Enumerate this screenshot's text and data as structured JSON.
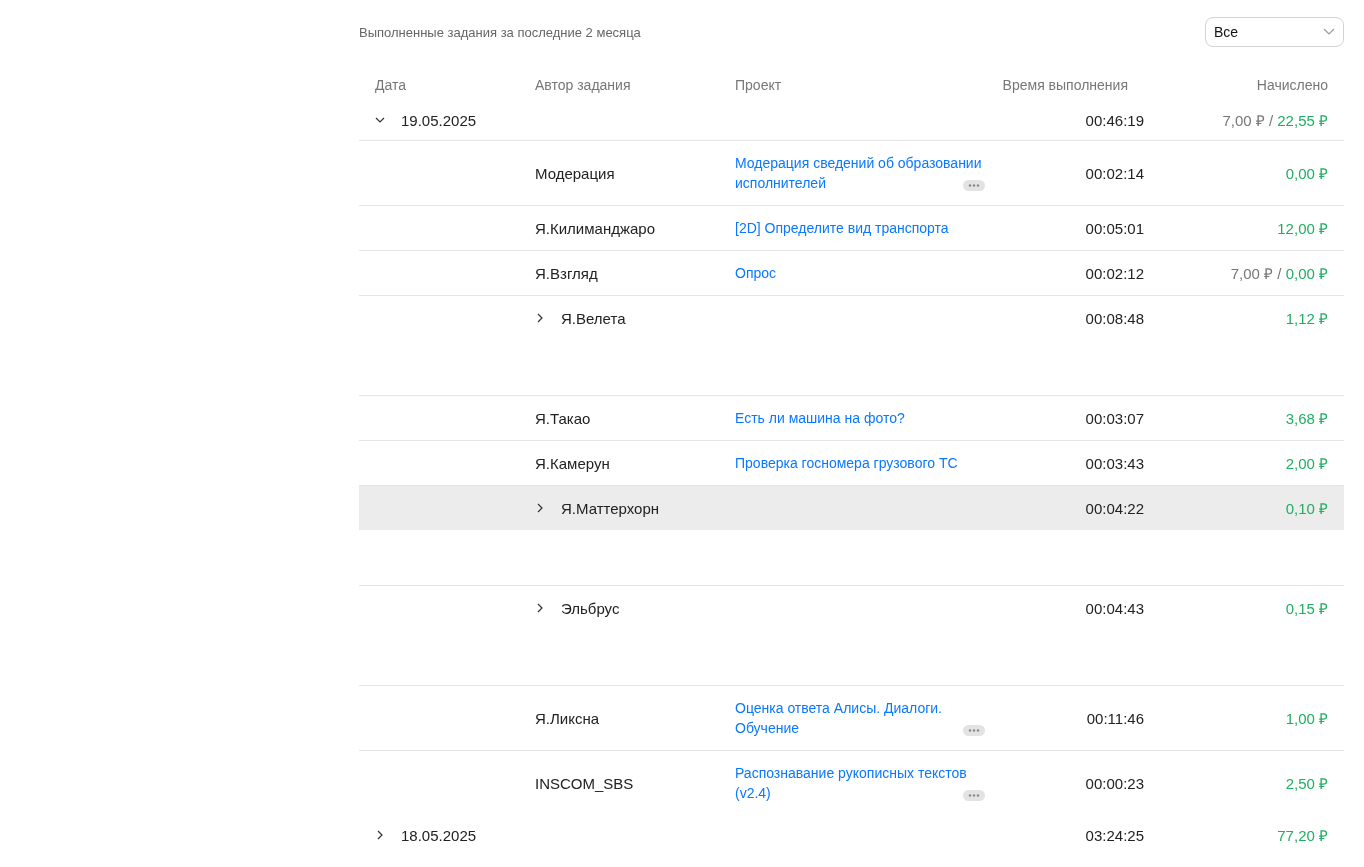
{
  "header": {
    "title": "Выполненные задания за последние 2 месяца",
    "filter": {
      "value": "Все"
    }
  },
  "columns": [
    "Дата",
    "Автор задания",
    "Проект",
    "Время выполнения",
    "Начислено"
  ],
  "groups": [
    {
      "date": "19.05.2025",
      "expanded": true,
      "time": "00:46:19",
      "pending": "7,00 ₽ /",
      "amount": "22,55 ₽",
      "rows": [
        {
          "kind": "task",
          "author": "Модерация",
          "project": "Модерация сведений об образовании исполнителей",
          "more": true,
          "time": "00:02:14",
          "amount": "0,00 ₽",
          "highlighted": false
        },
        {
          "kind": "task",
          "author": "Я.Килиманджаро",
          "project": "[2D] Определите вид транспорта",
          "more": false,
          "time": "00:05:01",
          "amount": "12,00 ₽",
          "highlighted": false
        },
        {
          "kind": "task",
          "author": "Я.Взгляд",
          "project": "Опрос",
          "more": false,
          "time": "00:02:12",
          "pending": "7,00 ₽ /",
          "amount": "0,00 ₽",
          "highlighted": false
        },
        {
          "kind": "group",
          "author": "Я.Велета",
          "expanded": false,
          "time": "00:08:48",
          "amount": "1,12 ₽",
          "highlighted": false
        },
        {
          "kind": "task",
          "author": "Я.Такао",
          "project": "Есть ли машина на фото?",
          "more": false,
          "time": "00:03:07",
          "amount": "3,68 ₽",
          "highlighted": false
        },
        {
          "kind": "task",
          "author": "Я.Камерун",
          "project": "Проверка госномера грузового ТС",
          "more": false,
          "time": "00:03:43",
          "amount": "2,00 ₽",
          "highlighted": false
        },
        {
          "kind": "group",
          "author": "Я.Маттерхорн",
          "expanded": false,
          "time": "00:04:22",
          "amount": "0,10 ₽",
          "highlighted": true
        },
        {
          "kind": "group",
          "author": "Эльбрус",
          "expanded": false,
          "time": "00:04:43",
          "amount": "0,15 ₽",
          "highlighted": false
        },
        {
          "kind": "task",
          "author": "Я.Ликсна",
          "project": "Оценка ответа Алисы. Диалоги. Обучение",
          "more": true,
          "time": "00:11:46",
          "amount": "1,00 ₽",
          "highlighted": false
        },
        {
          "kind": "task",
          "author": "INSCOM_SBS",
          "project": "Распознавание рукописных текстов (v2.4)",
          "more": true,
          "time": "00:00:23",
          "amount": "2,50 ₽",
          "highlighted": false
        }
      ]
    },
    {
      "date": "18.05.2025",
      "expanded": false,
      "time": "03:24:25",
      "amount": "77,20 ₽"
    }
  ]
}
